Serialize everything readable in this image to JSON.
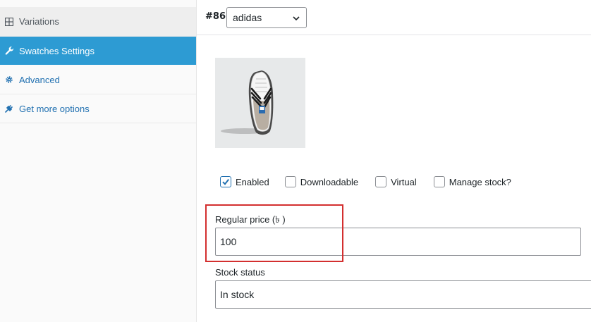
{
  "sidebar": {
    "items": [
      {
        "label": "Variations",
        "icon": "grid-icon"
      },
      {
        "label": "Swatches Settings",
        "icon": "wrench-icon"
      },
      {
        "label": "Advanced",
        "icon": "gear-icon"
      },
      {
        "label": "Get more options",
        "icon": "plug-icon"
      }
    ]
  },
  "variation": {
    "id": "#86",
    "selected": "adidas",
    "image_alt": "adidas sneaker product image",
    "checkboxes": [
      {
        "label": "Enabled",
        "checked": true
      },
      {
        "label": "Downloadable",
        "checked": false
      },
      {
        "label": "Virtual",
        "checked": false
      },
      {
        "label": "Manage stock?",
        "checked": false
      }
    ],
    "regular_price_label": "Regular price (৳ )",
    "regular_price_value": "100",
    "stock_status_label": "Stock status",
    "stock_status_value": "In stock"
  },
  "colors": {
    "active_sidebar": "#2d9bd3",
    "link": "#2271b1",
    "check": "#2271b1",
    "highlight": "#d32f2f"
  }
}
